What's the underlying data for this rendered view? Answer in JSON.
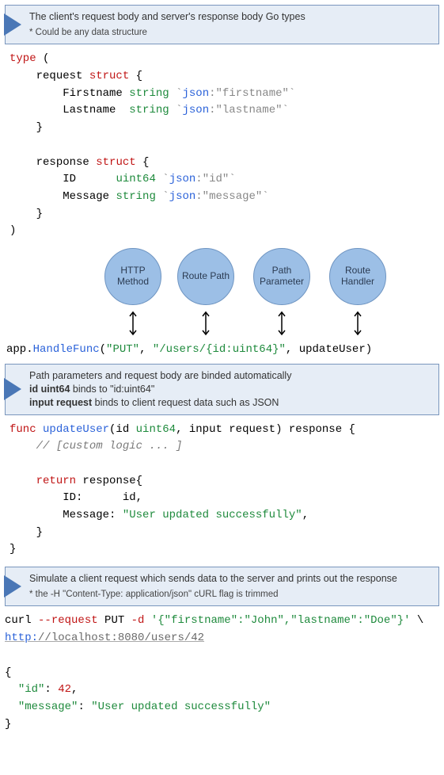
{
  "callout1": {
    "title": "The client's request body and server's response body Go types",
    "sub": "* Could be any data structure"
  },
  "code1": {
    "kw_type": "type",
    "lparen": " (",
    "req_name": "request",
    "kw_struct1": "struct",
    "brace_open": " {",
    "field_firstname": "Firstname",
    "type_string1": "string",
    "tag_open1": " `",
    "tag_json1": "json",
    "tag_val1": ":\"firstname\"",
    "tag_close1": "`",
    "field_lastname": "Lastname",
    "type_string2": "string",
    "tag_open2": " `",
    "tag_json2": "json",
    "tag_val2": ":\"lastname\"",
    "tag_close2": "`",
    "brace_close1": "}",
    "resp_name": "response",
    "kw_struct2": "struct",
    "field_id": "ID",
    "type_uint64": "uint64",
    "tag_json3": "json",
    "tag_val3": ":\"id\"",
    "field_message": "Message",
    "type_string3": "string",
    "tag_json4": "json",
    "tag_val4": ":\"message\"",
    "brace_close2": "}",
    "rparen": ")"
  },
  "bubbles": {
    "b0": "HTTP Method",
    "b1": "Route Path",
    "b2": "Path Parameter",
    "b3": "Route Handler"
  },
  "handleline": {
    "app": "app",
    "dot": ".",
    "fn": "HandleFunc",
    "open": "(",
    "arg0": "\"PUT\"",
    "comma1": ", ",
    "arg1": "\"/users/{id:uint64}\"",
    "comma2": ", ",
    "arg2": "updateUser",
    "close": ")"
  },
  "callout2": {
    "line1": "Path parameters and request body are binded automatically",
    "b1": "id uint64",
    "mid1": " binds to ",
    "q1": "\"id:uint64\"",
    "b2": "input request",
    "mid2": " binds to client request data such as JSON"
  },
  "code2": {
    "kw_func": "func",
    "name": "updateUser",
    "sig_open": "(id ",
    "t_uint64": "uint64",
    "sig_mid": ", input request) response {",
    "comment": "// [custom logic ... ]",
    "kw_return": "return",
    "ret_after": " response{",
    "f_id": "ID:",
    "v_id": "id,",
    "f_msg": "Message:",
    "v_msg": "\"User updated successfully\"",
    "comma": ",",
    "close1": "}",
    "close2": "}"
  },
  "callout3": {
    "line1": "Simulate a client request which sends data to the server and prints out the response",
    "sub": "* the -H \"Content-Type: application/json\" cURL flag is trimmed"
  },
  "curl": {
    "cmd": "curl ",
    "flag1": "--request",
    "method": " PUT ",
    "flag2": "-d",
    "space": " ",
    "body": "'{\"firstname\":\"John\",\"lastname\":\"Doe\"}'",
    "cont": " \\",
    "scheme": "http:",
    "rest": "//localhost:8080/users/42"
  },
  "resp": {
    "open": "{",
    "k_id": "\"id\"",
    "colon1": ": ",
    "v_id": "42",
    "comma": ",",
    "k_msg": "\"message\"",
    "colon2": ": ",
    "v_msg": "\"User updated successfully\"",
    "close": "}"
  }
}
